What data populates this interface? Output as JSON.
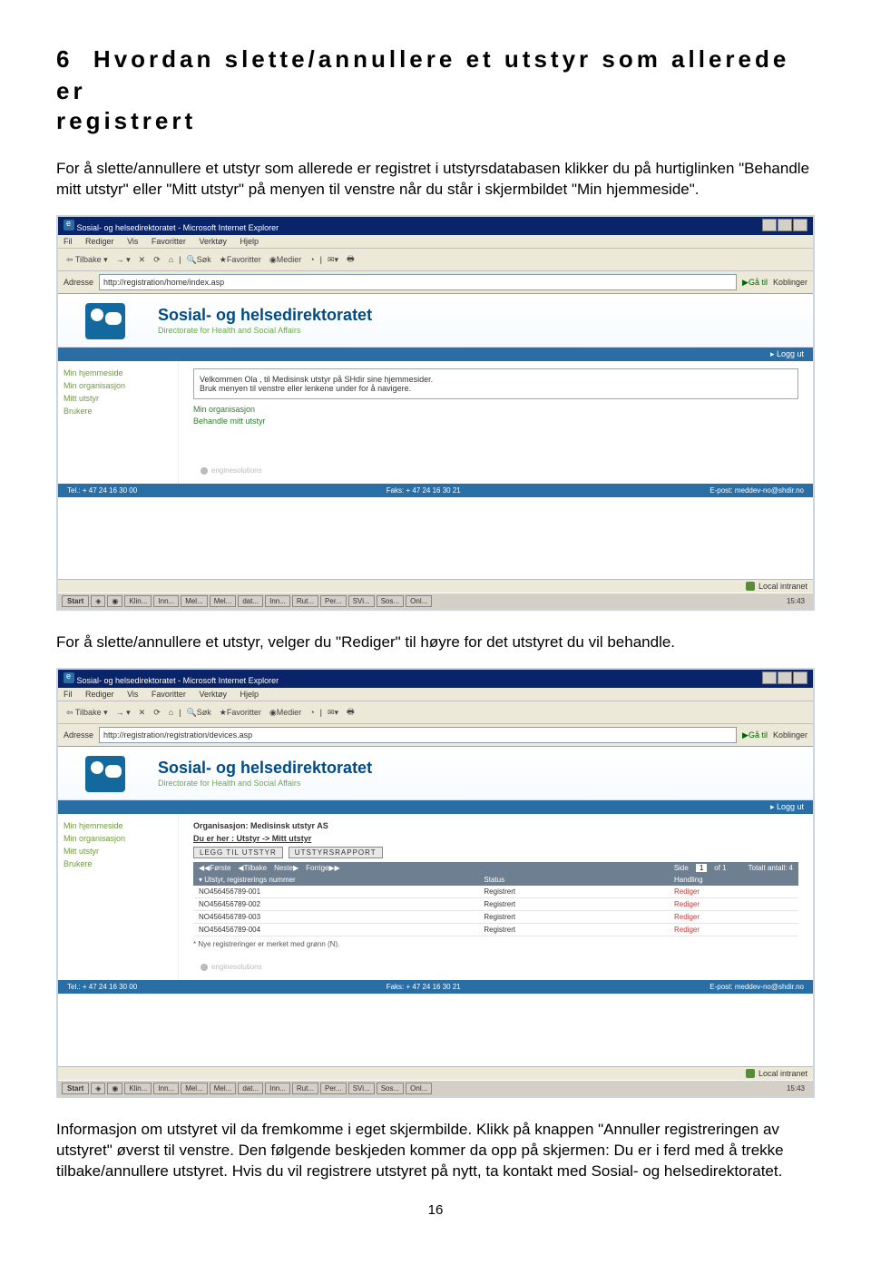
{
  "heading": {
    "num": "6",
    "title_l1": "Hvordan slette/annullere et utstyr som allerede er",
    "title_l2": "registrert"
  },
  "p1": "For å slette/annullere et utstyr som allerede er registret i utstyrsdatabasen klikker du på hurtiglinken \"Behandle mitt utstyr\" eller \"Mitt utstyr\" på menyen til venstre når du står i skjermbildet \"Min hjemmeside\".",
  "p2": "For å slette/annullere et utstyr, velger du \"Rediger\" til høyre for det utstyret du vil behandle.",
  "p3_a": "Informasjon om utstyret vil da fremkomme i eget skjermbilde",
  "p3_b": ". Klikk på knappen \"Annuller registreringen av utstyret\" øverst til venstre. Den følgende beskjeden kommer da opp på skjermen: Du er i ferd med å trekke tilbake/annullere utstyret. Hvis du vil registrere utstyret på nytt, ta kontakt med Sosial- og helsedirektoratet.",
  "page_num": "16",
  "browser": {
    "title": "Sosial- og helsedirektoratet - Microsoft Internet Explorer",
    "menus": [
      "Fil",
      "Rediger",
      "Vis",
      "Favoritter",
      "Verktøy",
      "Hjelp"
    ],
    "toolbar": {
      "back": "Tilbake",
      "search": "Søk",
      "fav": "Favoritter",
      "media": "Medier"
    },
    "addr_label": "Adresse",
    "go": "Gå til",
    "links": "Koblinger",
    "statusbar": "Local intranet"
  },
  "site": {
    "title": "Sosial- og helsedirektoratet",
    "subtitle": "Directorate for Health and Social Affairs",
    "logout": "Logg ut",
    "nav": [
      "Min hjemmeside",
      "Min organisasjon",
      "Mitt utstyr",
      "Brukere"
    ],
    "engines": "enginesolutions",
    "footer": {
      "tel": "Tel.: + 47 24 16 30 00",
      "fax": "Faks: + 47 24 16 30 21",
      "mail": "E-post: meddev-no@shdir.no"
    }
  },
  "shot1": {
    "url": "http://registration/home/index.asp",
    "welcome_l1": "Velkommen Ola , til Medisinsk utstyr på SHdir sine hjemmesider.",
    "welcome_l2": "Bruk menyen til venstre eller lenkene under for å navigere.",
    "link1": "Min organisasjon",
    "link2": "Behandle mitt utstyr"
  },
  "shot2": {
    "url": "http://registration/registration/devices.asp",
    "org": "Organisasjon: Medisinsk utstyr AS",
    "crumb": "Du er her : Utstyr -> Mitt utstyr",
    "btn1": "LEGG TIL UTSTYR",
    "btn2": "UTSTYRSRAPPORT",
    "pager": {
      "first": "Første",
      "prev": "Tilbake",
      "next": "Neste",
      "last": "Forrige",
      "side": "Side",
      "of": "of 1",
      "page": "1",
      "total": "Totalt antall: 4"
    },
    "cols": {
      "c1": "Utstyr, registrerings nummer",
      "c2": "Status",
      "c3": "Handling"
    },
    "rows": [
      {
        "no": "NO456456789-001",
        "st": "Registrert",
        "act": "Rediger"
      },
      {
        "no": "NO456456789-002",
        "st": "Registrert",
        "act": "Rediger"
      },
      {
        "no": "NO456456789-003",
        "st": "Registrert",
        "act": "Rediger"
      },
      {
        "no": "NO456456789-004",
        "st": "Registrert",
        "act": "Rediger"
      }
    ],
    "note": "* Nye registreringer er merket med grønn (N)."
  },
  "taskbar": {
    "start": "Start",
    "items": [
      "Klin...",
      "Inn...",
      "Mel...",
      "Mel...",
      "dat...",
      "Inn...",
      "Rut...",
      "Per...",
      "SVi...",
      "Sos...",
      "Onl..."
    ],
    "clock": "15:43"
  }
}
